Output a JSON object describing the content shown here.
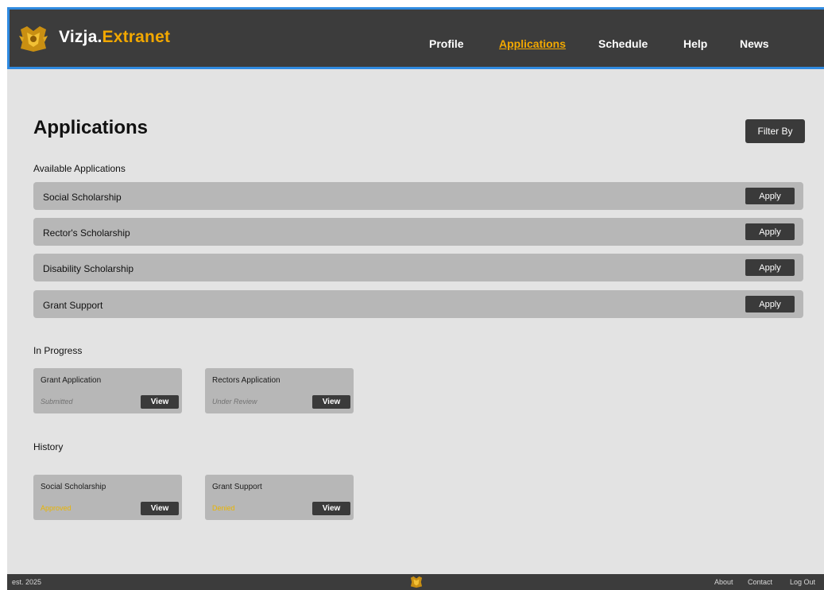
{
  "header": {
    "brand_main": "Vizja.",
    "brand_accent": "Extranet",
    "nav": [
      "Profile",
      "Applications",
      "Schedule",
      "Help",
      "News"
    ],
    "active_nav": "Applications"
  },
  "page": {
    "title": "Applications",
    "filter_label": "Filter By"
  },
  "available": {
    "label": "Available Applications",
    "apply_label": "Apply",
    "items": [
      "Social Scholarship",
      "Rector's Scholarship",
      "Disability Scholarship",
      "Grant Support"
    ]
  },
  "in_progress": {
    "label": "In Progress",
    "items": [
      {
        "title": "Grant Application",
        "status": "Submitted"
      },
      {
        "title": "Rectors Application",
        "status": "Under Review"
      }
    ]
  },
  "history": {
    "label": "History",
    "items": [
      {
        "title": "Social Scholarship",
        "status": "Approved"
      },
      {
        "title": "Grant Support",
        "status": "Denied"
      }
    ]
  },
  "view_label": "View",
  "colors": {
    "accent": "#f2a800",
    "header_bg": "#3c3c3c",
    "header_border": "#2f8ae0"
  },
  "footer": {
    "est": "est. 2025",
    "links": [
      "About",
      "Contact",
      "Log Out"
    ]
  }
}
